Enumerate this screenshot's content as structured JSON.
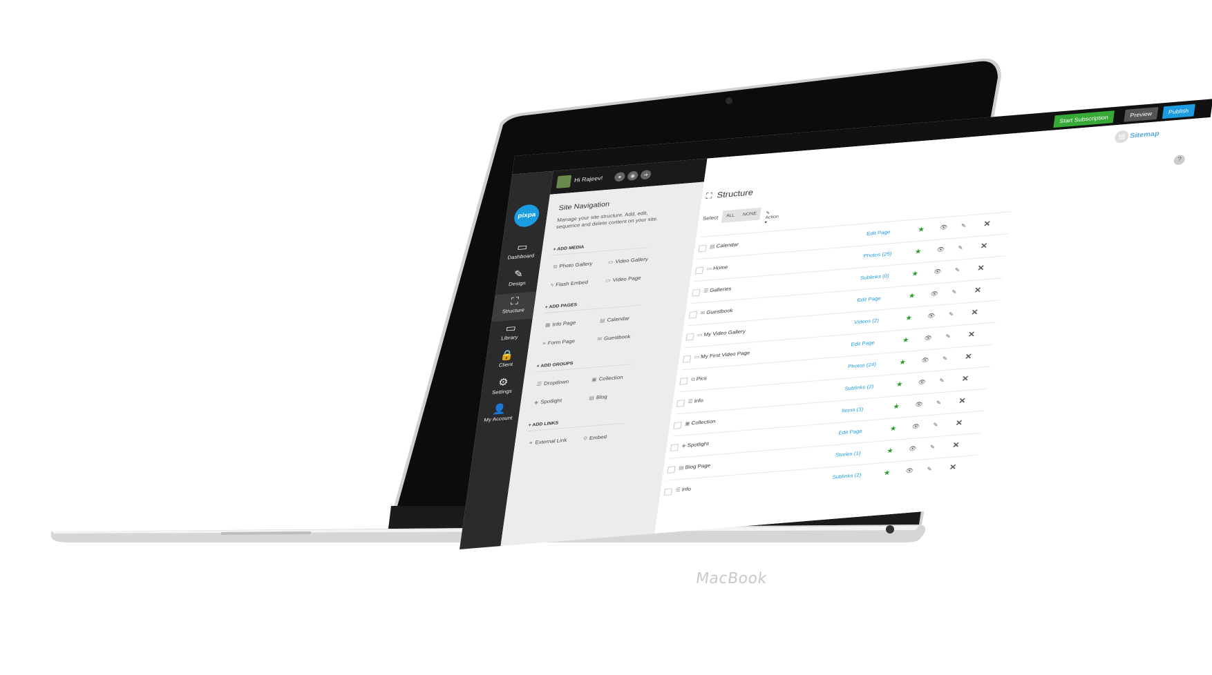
{
  "topbar": {
    "subscribe_label": "Start Subscription",
    "preview_label": "Preview",
    "publish_label": "Publish"
  },
  "user": {
    "greeting": "Hi Rajeev!"
  },
  "logo_text": "pixpa",
  "nav": [
    {
      "label": "Dashboard",
      "icon": "monitor-icon",
      "glyph": "▭"
    },
    {
      "label": "Design",
      "icon": "pencil-square-icon",
      "glyph": "✎"
    },
    {
      "label": "Structure",
      "icon": "sitemap-icon",
      "glyph": "⛶"
    },
    {
      "label": "Library",
      "icon": "monitor-icon",
      "glyph": "▭"
    },
    {
      "label": "Client",
      "icon": "lock-icon",
      "glyph": "🔒"
    },
    {
      "label": "Settings",
      "icon": "gear-icon",
      "glyph": "⚙"
    },
    {
      "label": "My Account",
      "icon": "user-icon",
      "glyph": "👤"
    }
  ],
  "sidepanel": {
    "title": "Site Navigation",
    "description": "Manage your site structure. Add, edit, sequence and delete content on your site.",
    "sections": [
      {
        "heading": "+ ADD MEDIA",
        "items": [
          "Photo Gallery",
          "Video Gallery",
          "Flash Embed",
          "Video Page"
        ]
      },
      {
        "heading": "+ ADD PAGES",
        "items": [
          "Info Page",
          "Calendar",
          "Form Page",
          "Guestbook"
        ]
      },
      {
        "heading": "+ ADD GROUPS",
        "items": [
          "Dropdown",
          "Collection",
          "Spotlight",
          "Blog"
        ]
      },
      {
        "heading": "+ ADD LINKS",
        "items": [
          "External Link",
          "Embed"
        ]
      }
    ]
  },
  "main": {
    "sitemap_label": "Sitemap",
    "help_label": "?",
    "title": "Structure",
    "select_label": "Select",
    "all_label": "ALL",
    "none_label": "NONE",
    "action_label": "Action"
  },
  "rows": [
    {
      "name": "Calendar",
      "link": "Edit Page"
    },
    {
      "name": "Home",
      "link": "Photos (25)"
    },
    {
      "name": "Galleries",
      "link": "Sublinks (0)"
    },
    {
      "name": "Guestbook",
      "link": "Edit Page"
    },
    {
      "name": "My Video Gallery",
      "link": "Videos (2)"
    },
    {
      "name": "My First Video Page",
      "link": "Edit Page"
    },
    {
      "name": "Pics",
      "link": "Photos (24)"
    },
    {
      "name": "Info",
      "link": "Sublinks (2)"
    },
    {
      "name": "Collection",
      "link": "Items (3)"
    },
    {
      "name": "Spotlight",
      "link": "Edit Page"
    },
    {
      "name": "Blog Page",
      "link": "Stories (1)"
    },
    {
      "name": "Info",
      "link": "Sublinks (2)"
    }
  ],
  "device_label": "MacBook",
  "colors": {
    "accent": "#1b9be0",
    "subscribe": "#37a936",
    "star": "#2a9a2a"
  }
}
